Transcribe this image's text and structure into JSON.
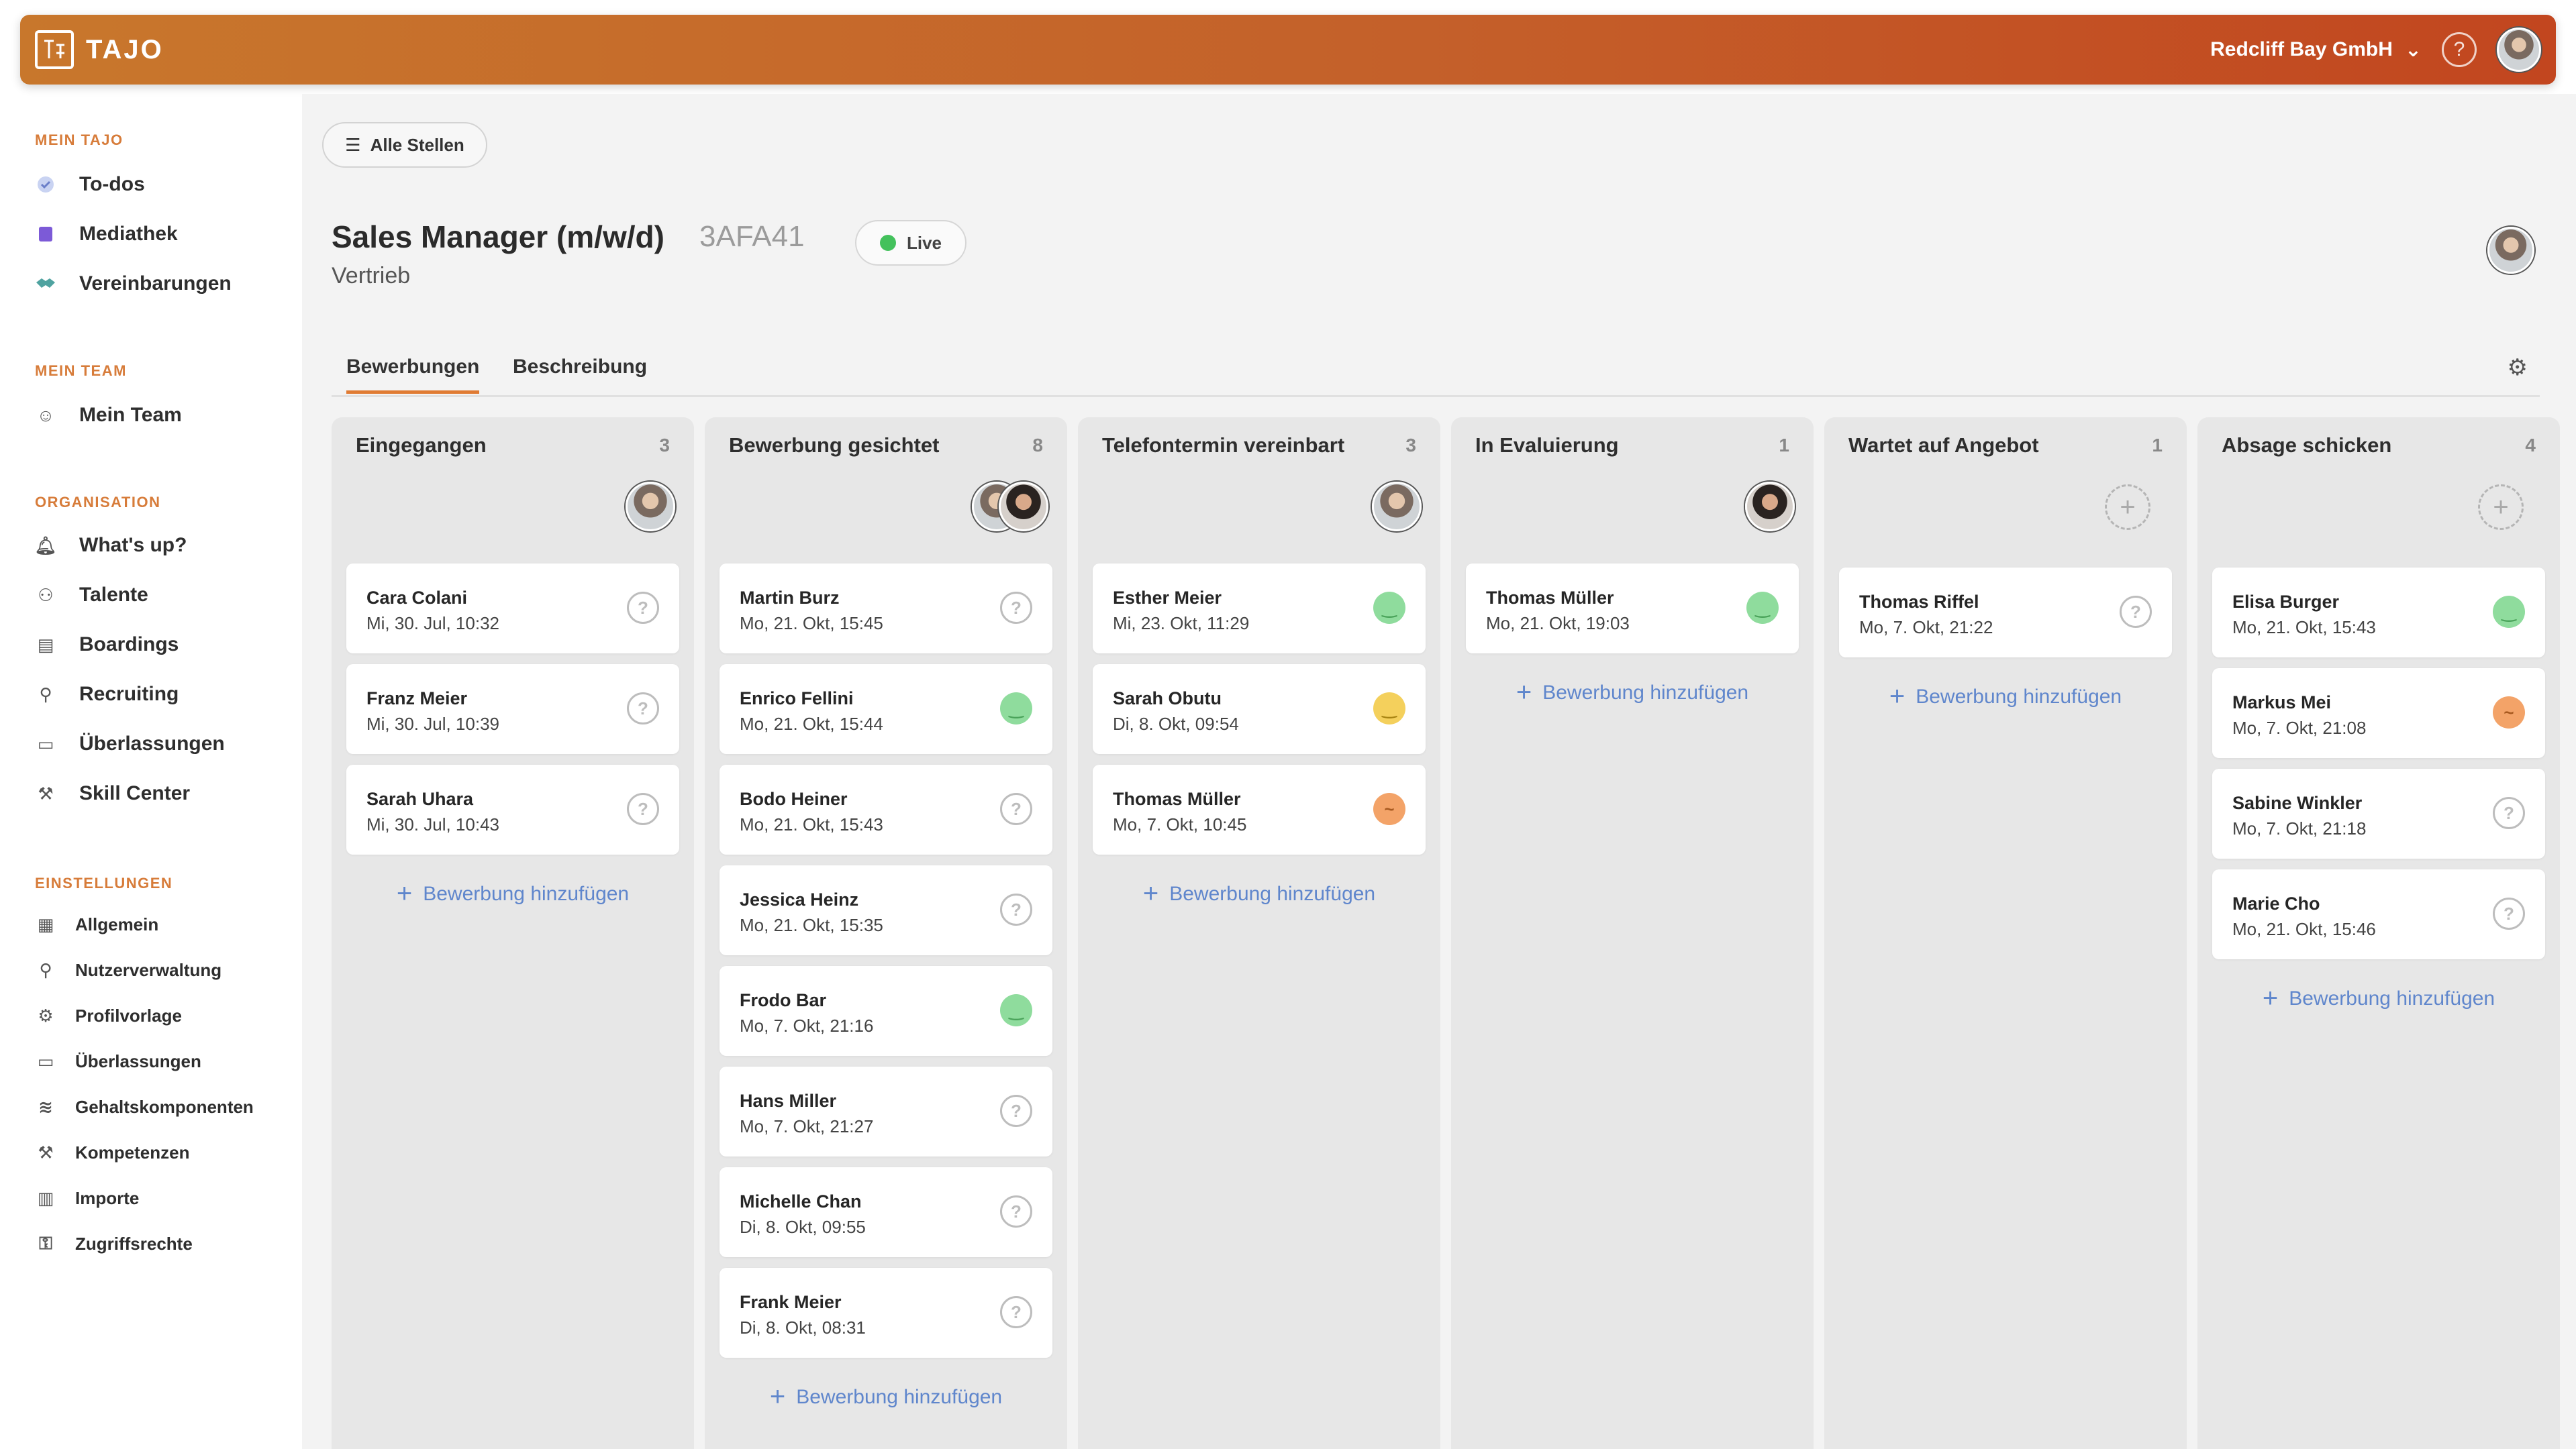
{
  "header": {
    "logo_text": "TAJO",
    "company": "Redcliff Bay GmbH",
    "help": "?"
  },
  "sidebar": {
    "sections": [
      {
        "title": "MEIN TAJO",
        "items": [
          {
            "label": "To-dos",
            "icon": "check-circle-icon"
          },
          {
            "label": "Mediathek",
            "icon": "book-icon"
          },
          {
            "label": "Vereinbarungen",
            "icon": "handshake-icon"
          }
        ]
      },
      {
        "title": "MEIN TEAM",
        "items": [
          {
            "label": "Mein Team",
            "icon": "smiley-icon"
          }
        ]
      },
      {
        "title": "ORGANISATION",
        "items": [
          {
            "label": "What's up?",
            "icon": "bell-icon"
          },
          {
            "label": "Talente",
            "icon": "people-icon"
          },
          {
            "label": "Boardings",
            "icon": "clipboard-icon"
          },
          {
            "label": "Recruiting",
            "icon": "user-search-icon"
          },
          {
            "label": "Überlassungen",
            "icon": "devices-icon"
          },
          {
            "label": "Skill Center",
            "icon": "hammer-icon"
          }
        ]
      },
      {
        "title": "EINSTELLUNGEN",
        "items": [
          {
            "label": "Allgemein",
            "icon": "building-icon"
          },
          {
            "label": "Nutzerverwaltung",
            "icon": "person-icon"
          },
          {
            "label": "Profilvorlage",
            "icon": "user-gear-icon"
          },
          {
            "label": "Überlassungen",
            "icon": "devices-icon"
          },
          {
            "label": "Gehaltskomponenten",
            "icon": "coins-icon"
          },
          {
            "label": "Kompetenzen",
            "icon": "hammer-icon"
          },
          {
            "label": "Importe",
            "icon": "file-import-icon"
          },
          {
            "label": "Zugriffsrechte",
            "icon": "key-icon"
          }
        ]
      }
    ]
  },
  "main": {
    "back_button": "Alle Stellen",
    "job_title": "Sales Manager (m/w/d)",
    "job_code": "3AFA41",
    "status": "Live",
    "department": "Vertrieb",
    "tabs": [
      "Bewerbungen",
      "Beschreibung"
    ],
    "add_label": "Bewerbung hinzufügen",
    "columns": [
      {
        "title": "Eingegangen",
        "count": "3",
        "cards": [
          {
            "name": "Cara Colani",
            "date": "Mi, 30. Jul, 10:32",
            "status": "unknown"
          },
          {
            "name": "Franz Meier",
            "date": "Mi, 30. Jul, 10:39",
            "status": "unknown"
          },
          {
            "name": "Sarah Uhara",
            "date": "Mi, 30. Jul, 10:43",
            "status": "unknown"
          }
        ]
      },
      {
        "title": "Bewerbung gesichtet",
        "count": "8",
        "cards": [
          {
            "name": "Martin Burz",
            "date": "Mo, 21. Okt, 15:45",
            "status": "unknown"
          },
          {
            "name": "Enrico Fellini",
            "date": "Mo, 21. Okt, 15:44",
            "status": "happy"
          },
          {
            "name": "Bodo Heiner",
            "date": "Mo, 21. Okt, 15:43",
            "status": "unknown"
          },
          {
            "name": "Jessica Heinz",
            "date": "Mo, 21. Okt, 15:35",
            "status": "unknown"
          },
          {
            "name": "Frodo Bar",
            "date": "Mo, 7. Okt, 21:16",
            "status": "happy"
          },
          {
            "name": "Hans Miller",
            "date": "Mo, 7. Okt, 21:27",
            "status": "unknown"
          },
          {
            "name": "Michelle Chan",
            "date": "Di, 8. Okt, 09:55",
            "status": "unknown"
          },
          {
            "name": "Frank Meier",
            "date": "Di, 8. Okt, 08:31",
            "status": "unknown"
          }
        ]
      },
      {
        "title": "Telefontermin vereinbart",
        "count": "3",
        "cards": [
          {
            "name": "Esther Meier",
            "date": "Mi, 23. Okt, 11:29",
            "status": "happy"
          },
          {
            "name": "Sarah Obutu",
            "date": "Di, 8. Okt, 09:54",
            "status": "neutral"
          },
          {
            "name": "Thomas Müller",
            "date": "Mo, 7. Okt, 10:45",
            "status": "think"
          }
        ]
      },
      {
        "title": "In Evaluierung",
        "count": "1",
        "cards": [
          {
            "name": "Thomas Müller",
            "date": "Mo, 21. Okt, 19:03",
            "status": "happy"
          }
        ]
      },
      {
        "title": "Wartet auf Angebot",
        "count": "1",
        "cards": [
          {
            "name": "Thomas Riffel",
            "date": "Mo, 7. Okt, 21:22",
            "status": "unknown"
          }
        ]
      },
      {
        "title": "Absage schicken",
        "count": "4",
        "cards": [
          {
            "name": "Elisa Burger",
            "date": "Mo, 21. Okt, 15:43",
            "status": "happy"
          },
          {
            "name": "Markus Mei",
            "date": "Mo, 7. Okt, 21:08",
            "status": "think"
          },
          {
            "name": "Sabine Winkler",
            "date": "Mo, 7. Okt, 21:18",
            "status": "unknown"
          },
          {
            "name": "Marie Cho",
            "date": "Mo, 21. Okt, 15:46",
            "status": "unknown"
          }
        ]
      }
    ]
  }
}
